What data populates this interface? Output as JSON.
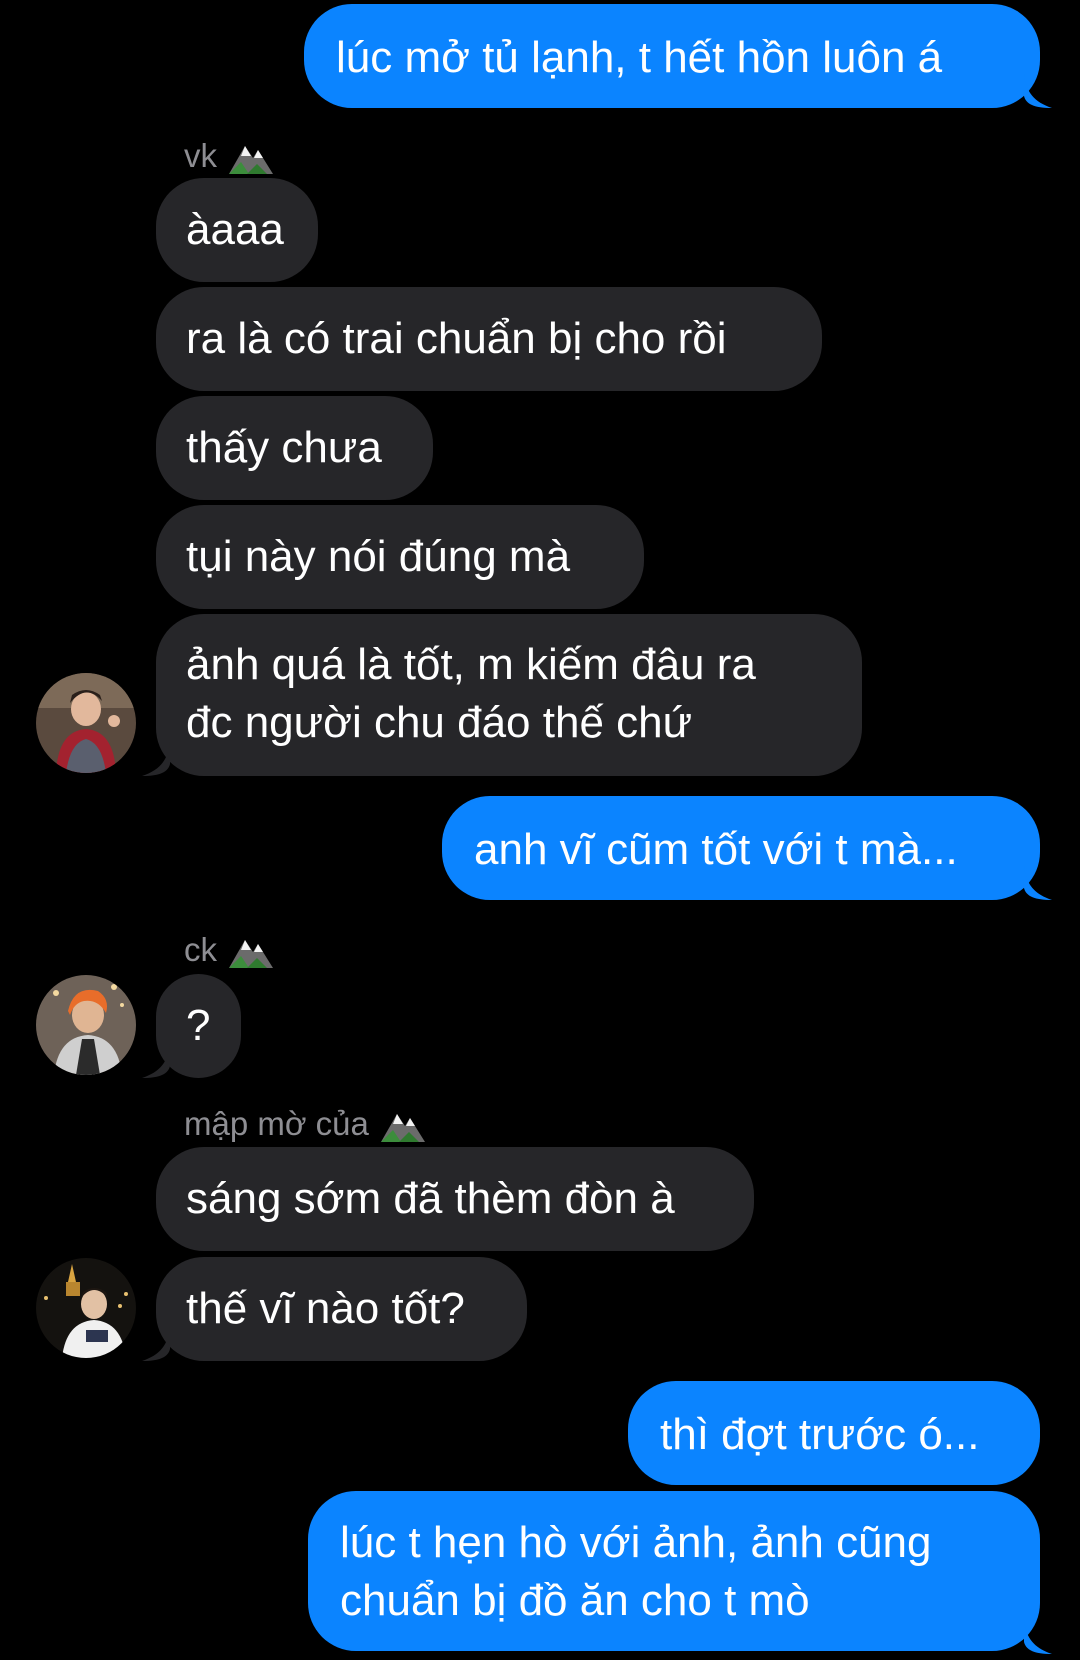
{
  "messages": [
    {
      "from": "me",
      "text": "lúc mở tủ lạnh, t hết hồn luôn á"
    },
    {
      "from": "vk",
      "text": "àaaa"
    },
    {
      "from": "vk",
      "text": "ra là có trai chuẩn bị cho rồi"
    },
    {
      "from": "vk",
      "text": "thấy chưa"
    },
    {
      "from": "vk",
      "text": "tụi này nói đúng mà"
    },
    {
      "from": "vk",
      "text": "ảnh quá là tốt, m kiếm đâu ra"
    },
    {
      "from": "vk",
      "text": "đc người chu đáo thế chứ"
    },
    {
      "from": "me",
      "text": "anh vĩ cũm tốt với t mà..."
    },
    {
      "from": "ck",
      "text": "?"
    },
    {
      "from": "map",
      "text": "sáng sớm đã thèm đòn à"
    },
    {
      "from": "map",
      "text": "thế vĩ nào tốt?"
    },
    {
      "from": "me",
      "text": "thì đợt trước ó..."
    },
    {
      "from": "me",
      "text": "lúc t hẹn hò với ảnh, ảnh cũng"
    },
    {
      "from": "me",
      "text": "chuẩn bị đồ ăn cho t mò"
    }
  ],
  "senders": {
    "vk": "vk",
    "ck": "ck",
    "map": "mập mờ của"
  },
  "icons": {
    "sender_badge": "mountain-icon",
    "avatar": "avatar-photo"
  },
  "colors": {
    "background": "#000000",
    "outgoing_bubble": "#0b84ff",
    "incoming_bubble": "#262629",
    "sender_label": "#8e8e93"
  }
}
